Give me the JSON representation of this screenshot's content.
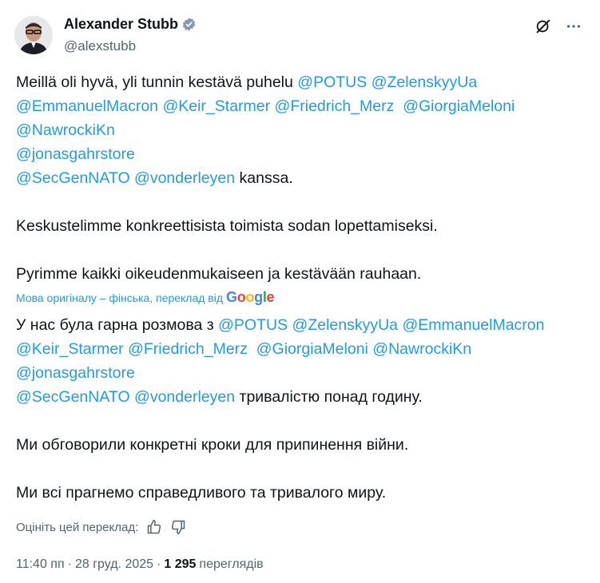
{
  "author": {
    "display_name": "Alexander Stubb",
    "handle": "@alexstubb"
  },
  "tweet": {
    "lines": [
      [
        {
          "t": "Meillä oli hyvä, yli tunnin kestävä puhelu "
        },
        {
          "t": "@POTUS",
          "m": true
        },
        {
          "t": " "
        },
        {
          "t": "@ZelenskyyUa",
          "m": true
        }
      ],
      [
        {
          "t": "@EmmanuelMacron",
          "m": true
        },
        {
          "t": " "
        },
        {
          "t": "@Keir_Starmer",
          "m": true
        },
        {
          "t": " "
        },
        {
          "t": "@Friedrich_Merz",
          "m": true
        },
        {
          "t": "  "
        },
        {
          "t": "@GiorgiaMeloni",
          "m": true
        }
      ],
      [
        {
          "t": "@NawrockiKn",
          "m": true
        }
      ],
      [
        {
          "t": "@jonasgahrstore",
          "m": true
        }
      ],
      [
        {
          "t": "@SecGenNATO",
          "m": true
        },
        {
          "t": " "
        },
        {
          "t": "@vonderleyen",
          "m": true
        },
        {
          "t": " kanssa."
        }
      ],
      [],
      [
        {
          "t": "Keskustelimme konkreettisista toimista sodan lopettamiseksi."
        }
      ],
      [],
      [
        {
          "t": "Pyrimme kaikki oikeudenmukaiseen ja kestävään rauhaan."
        }
      ]
    ]
  },
  "translated_by": {
    "label": "Мова оригіналу – фінська, переклад від",
    "google": [
      "G",
      "o",
      "o",
      "g",
      "l",
      "e"
    ]
  },
  "translation": {
    "lines": [
      [
        {
          "t": "У нас була гарна розмова з "
        },
        {
          "t": "@POTUS",
          "m": true
        },
        {
          "t": " "
        },
        {
          "t": "@ZelenskyyUa",
          "m": true
        },
        {
          "t": " "
        },
        {
          "t": "@EmmanuelMacron",
          "m": true
        }
      ],
      [
        {
          "t": "@Keir_Starmer",
          "m": true
        },
        {
          "t": " "
        },
        {
          "t": "@Friedrich_Merz",
          "m": true
        },
        {
          "t": "  "
        },
        {
          "t": "@GiorgiaMeloni",
          "m": true
        },
        {
          "t": " "
        },
        {
          "t": "@NawrockiKn",
          "m": true
        }
      ],
      [
        {
          "t": "@jonasgahrstore",
          "m": true
        }
      ],
      [
        {
          "t": "@SecGenNATO",
          "m": true
        },
        {
          "t": " "
        },
        {
          "t": "@vonderleyen",
          "m": true
        },
        {
          "t": " тривалістю понад годину."
        }
      ],
      [],
      [
        {
          "t": "Ми обговорили конкретні кроки для припинення війни."
        }
      ],
      [],
      [
        {
          "t": "Ми всі прагнемо справедливого та тривалого миру."
        }
      ]
    ]
  },
  "rate": {
    "label": "Оцініть цей переклад:"
  },
  "meta": {
    "time": "11:40 пп",
    "sep1": "·",
    "date": "28 груд. 2025",
    "sep2": "·",
    "views_count": "1 295",
    "views_label": "переглядів"
  },
  "colors": {
    "mention": "#1d9bf0",
    "text": "#0f1419",
    "muted": "#536471"
  },
  "icons": [
    "avatar",
    "verified-badge-icon",
    "grok-icon",
    "more-options-icon",
    "thumbs-up-icon",
    "thumbs-down-icon"
  ]
}
